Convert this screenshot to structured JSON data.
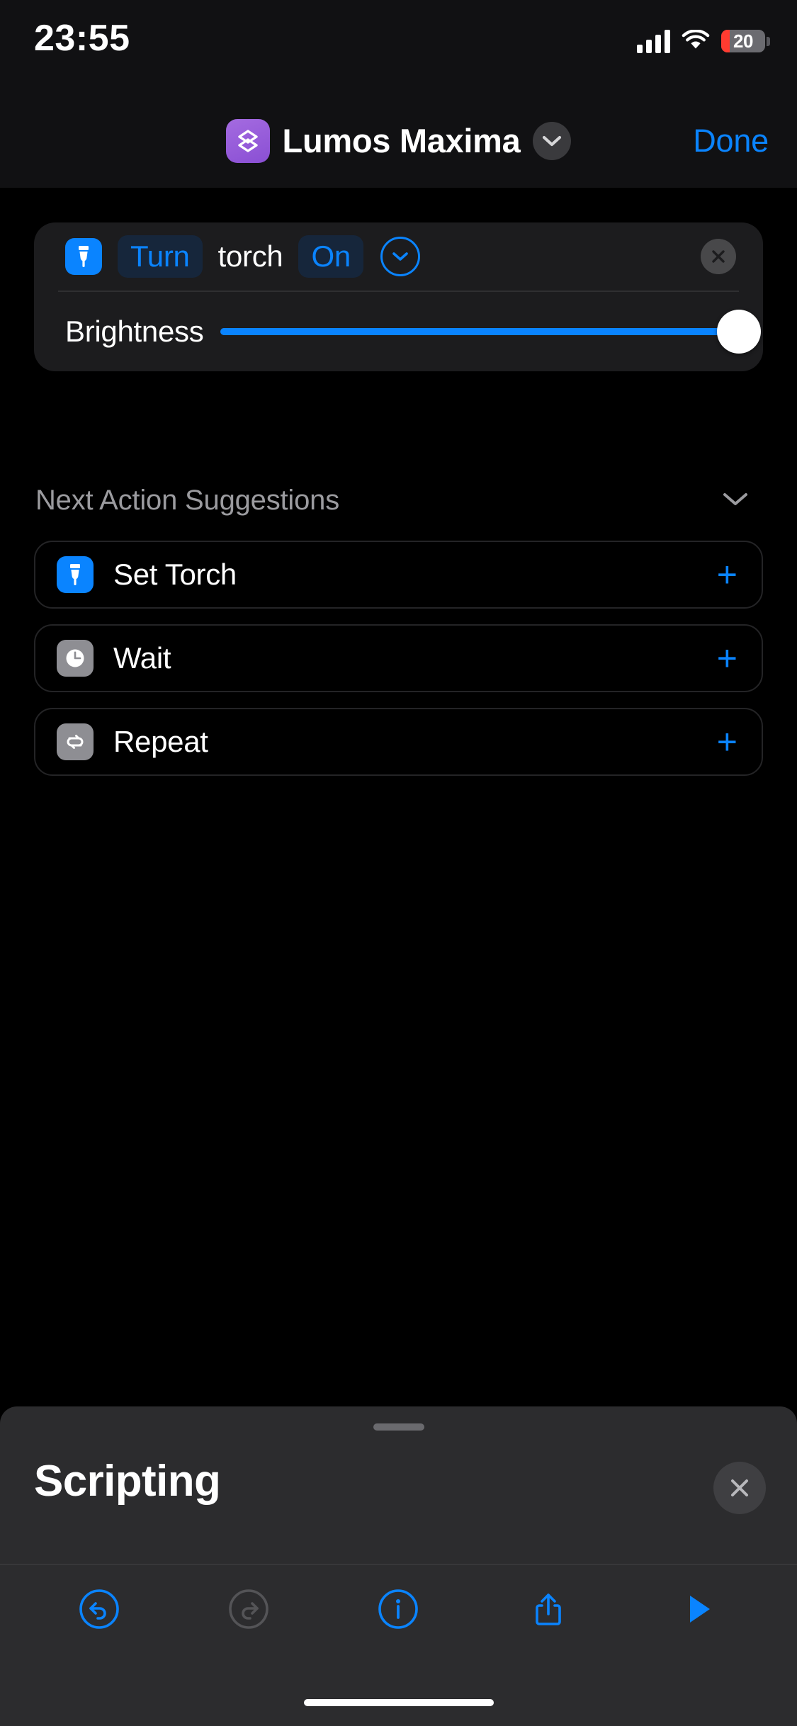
{
  "status_bar": {
    "time": "23:55",
    "battery_level": "20",
    "signal_icon": "cellular-signal-icon",
    "wifi_icon": "wifi-icon",
    "battery_icon": "battery-icon"
  },
  "nav": {
    "app_icon": "shortcuts-app-icon",
    "title": "Lumos Maxima",
    "chevron_icon": "chevron-down-icon",
    "done_label": "Done"
  },
  "action_card": {
    "icon": "flashlight-icon",
    "verb": "Turn",
    "object": "torch",
    "state": "On",
    "expand_icon": "chevron-down-circle-icon",
    "remove_icon": "close-icon",
    "slider": {
      "label": "Brightness",
      "value": 100,
      "min": 0,
      "max": 100
    }
  },
  "suggestions": {
    "header": "Next Action Suggestions",
    "collapse_icon": "chevron-down-icon",
    "add_icon": "plus-icon",
    "items": [
      {
        "label": "Set Torch",
        "icon": "flashlight-icon",
        "icon_color": "#0a84ff"
      },
      {
        "label": "Wait",
        "icon": "clock-icon",
        "icon_color": "#8e8e93"
      },
      {
        "label": "Repeat",
        "icon": "repeat-icon",
        "icon_color": "#8e8e93"
      }
    ]
  },
  "sheet": {
    "title": "Scripting",
    "close_icon": "close-icon",
    "grabber": "drag-handle"
  },
  "toolbar": {
    "items": [
      {
        "name": "undo-button",
        "icon": "undo-icon",
        "enabled": true
      },
      {
        "name": "redo-button",
        "icon": "redo-icon",
        "enabled": false
      },
      {
        "name": "info-button",
        "icon": "info-icon",
        "enabled": true
      },
      {
        "name": "share-button",
        "icon": "share-icon",
        "enabled": true
      },
      {
        "name": "run-button",
        "icon": "play-icon",
        "enabled": true
      }
    ]
  },
  "colors": {
    "accent": "#0a84ff",
    "app_icon": "#8a4fd4",
    "battery_low": "#ff3b30",
    "card_bg": "#1c1c1e",
    "sheet_bg": "#2c2c2e"
  }
}
